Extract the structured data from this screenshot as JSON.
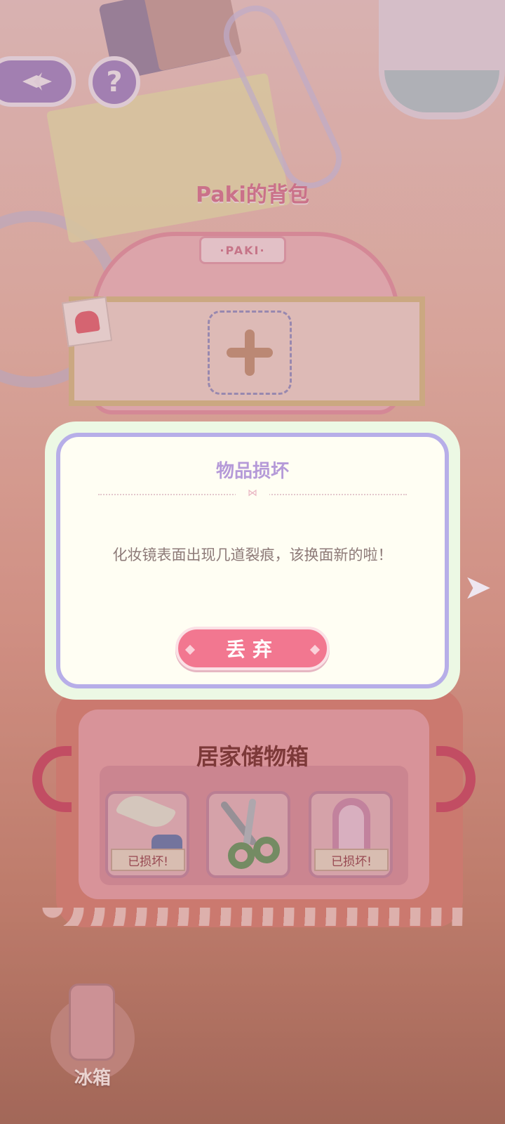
{
  "header": {
    "back_icon": "compass-arrow-icon",
    "help_label": "?"
  },
  "backpack": {
    "title": "Paki的背包",
    "label": "·PAKI·",
    "add_icon": "plus-icon"
  },
  "dialog": {
    "title": "物品损坏",
    "message": "化妆镜表面出现几道裂痕，该换面新的啦！",
    "button_label": "丢弃"
  },
  "storage_box": {
    "title": "居家储物箱",
    "items": [
      {
        "name": "quill-and-ink",
        "status": "已损坏!"
      },
      {
        "name": "scissors",
        "status": ""
      },
      {
        "name": "vanity-mirror",
        "status": "已损坏!"
      }
    ]
  },
  "fridge": {
    "label": "冰箱"
  },
  "colors": {
    "accent_purple": "#a88cc8",
    "discard_button": "#f27790",
    "dialog_border": "#b7aee8",
    "title_pink": "#d87a98"
  }
}
